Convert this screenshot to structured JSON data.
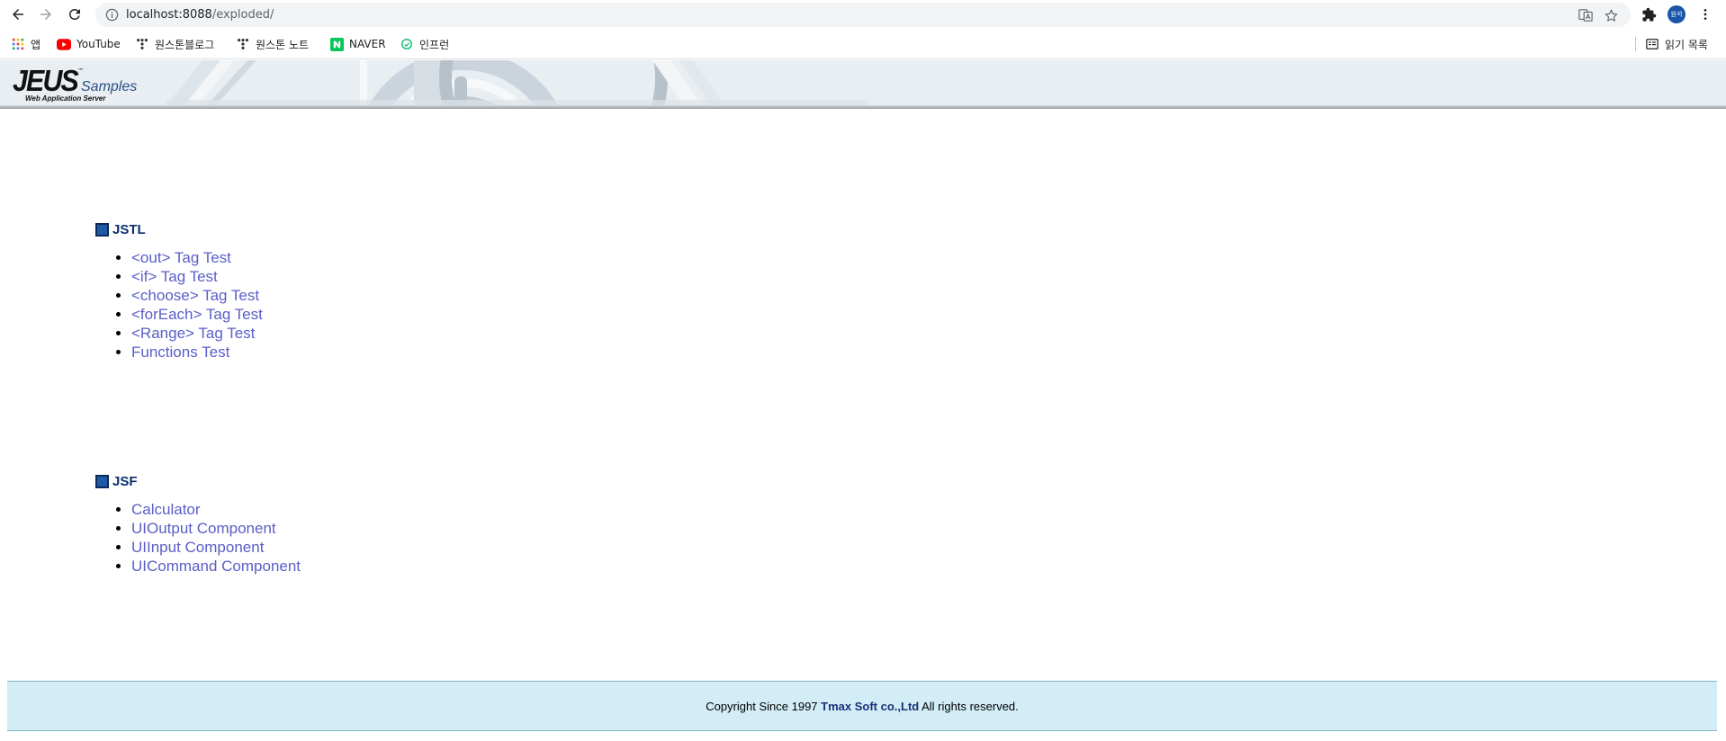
{
  "browser": {
    "url_host": "localhost:8088",
    "url_path": "/exploded/",
    "profile_initials": "원석",
    "bookmarks": [
      {
        "label": "앱",
        "icon": "apps-grid-icon"
      },
      {
        "label": "YouTube",
        "icon": "youtube-icon"
      },
      {
        "label": "원스톤블로그",
        "icon": "tstory-icon"
      },
      {
        "label": "원스톤 노트",
        "icon": "tstory-icon"
      },
      {
        "label": "NAVER",
        "icon": "naver-icon"
      },
      {
        "label": "인프런",
        "icon": "inflearn-icon"
      }
    ],
    "reading_list_label": "읽기 목록"
  },
  "banner": {
    "logo_text": "JEUS",
    "logo_tm": "™",
    "logo_subtitle": "Samples",
    "logo_tagline": "Web Application Server"
  },
  "sections": [
    {
      "title": "JSTL",
      "links": [
        "<out> Tag Test",
        "<if> Tag Test",
        "<choose> Tag Test",
        "<forEach> Tag Test",
        "<Range> Tag Test",
        "Functions Test"
      ]
    },
    {
      "title": "JSF",
      "links": [
        "Calculator",
        "UIOutput Component",
        "UIInput Component",
        "UICommand Component"
      ]
    }
  ],
  "footer": {
    "prefix": "Copyright Since 1997 ",
    "company": "Tmax Soft co.,Ltd",
    "suffix": " All rights reserved."
  },
  "colors": {
    "link": "#5a5ec6",
    "section_title": "#0a2f6e",
    "footer_bg": "#d2edf6"
  }
}
